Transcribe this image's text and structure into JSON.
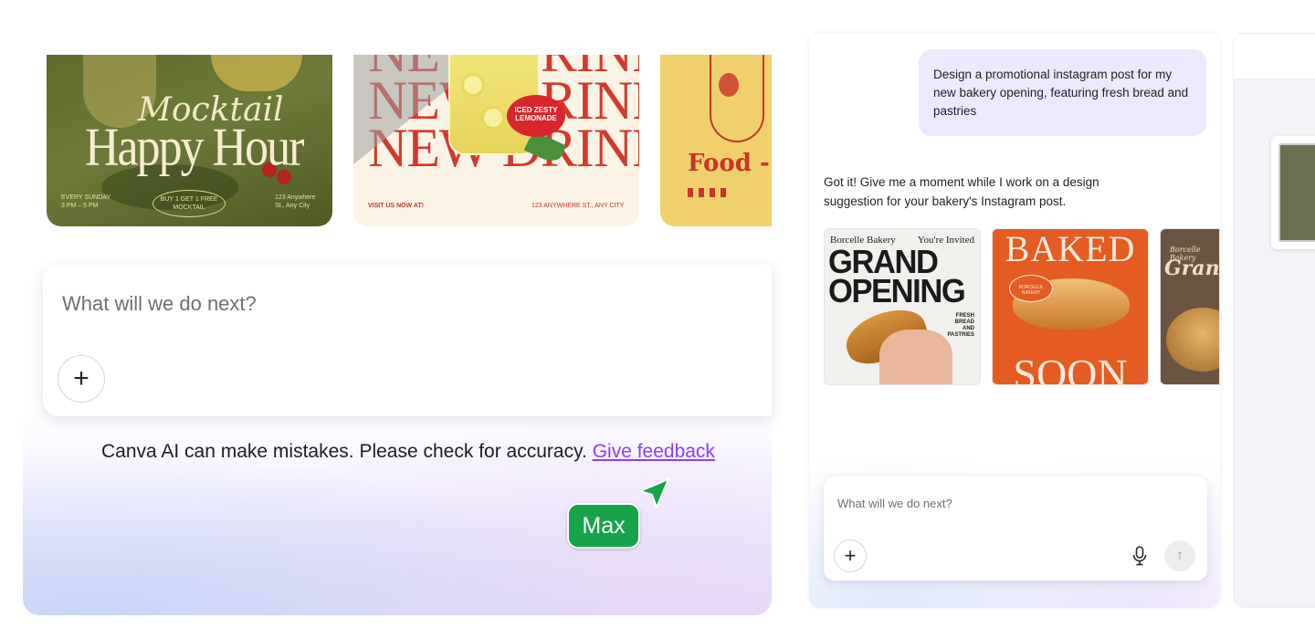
{
  "templates": {
    "mocktail": {
      "script_title": "Mocktail",
      "big_title": "Happy Hour",
      "footer_left": "EVERY SUNDAY\n3 PM – 5 PM",
      "footer_mid": "BUY 1 GET 1 FREE\nMOCKTAIL",
      "footer_right": "123 Anywhere\nSt., Any City"
    },
    "drink": {
      "line": "NEW DRINK",
      "badge": "ICED ZESTY LEMONADE",
      "footer_left": "VISIT US NOW AT!",
      "footer_right": "123 ANYWHERE ST., ANY CITY"
    },
    "food": {
      "word": "Food - I"
    }
  },
  "prompt": {
    "placeholder": "What will we do next?",
    "add_label": "+"
  },
  "disclaimer": {
    "text": "Canva AI can make mistakes. Please check for accuracy. ",
    "link": "Give feedback"
  },
  "collaborator": {
    "name": "Max",
    "color": "#16a34a"
  },
  "chat": {
    "user_message": "Design a promotional instagram post for my new bakery opening, featuring fresh bread and pastries",
    "ai_message": "Got it! Give me a moment while I work on a design suggestion for your bakery's Instagram post.",
    "suggestions": [
      {
        "brand": "Borcelle Bakery",
        "invite": "You're Invited",
        "title": "GRAND OPENING",
        "side": "FRESH BREAD AND PASTRIES"
      },
      {
        "top": "BAKED",
        "bottom": "SOON",
        "stamp": "BORCELLE BAKERY"
      },
      {
        "small": "Borcelle Bakery",
        "script": "Grand"
      }
    ],
    "input_placeholder": "What will we do next?",
    "add_label": "+",
    "send_label": "↑"
  },
  "colors": {
    "accent_purple": "#8b3dff",
    "user_bubble": "#ebe9fd"
  }
}
